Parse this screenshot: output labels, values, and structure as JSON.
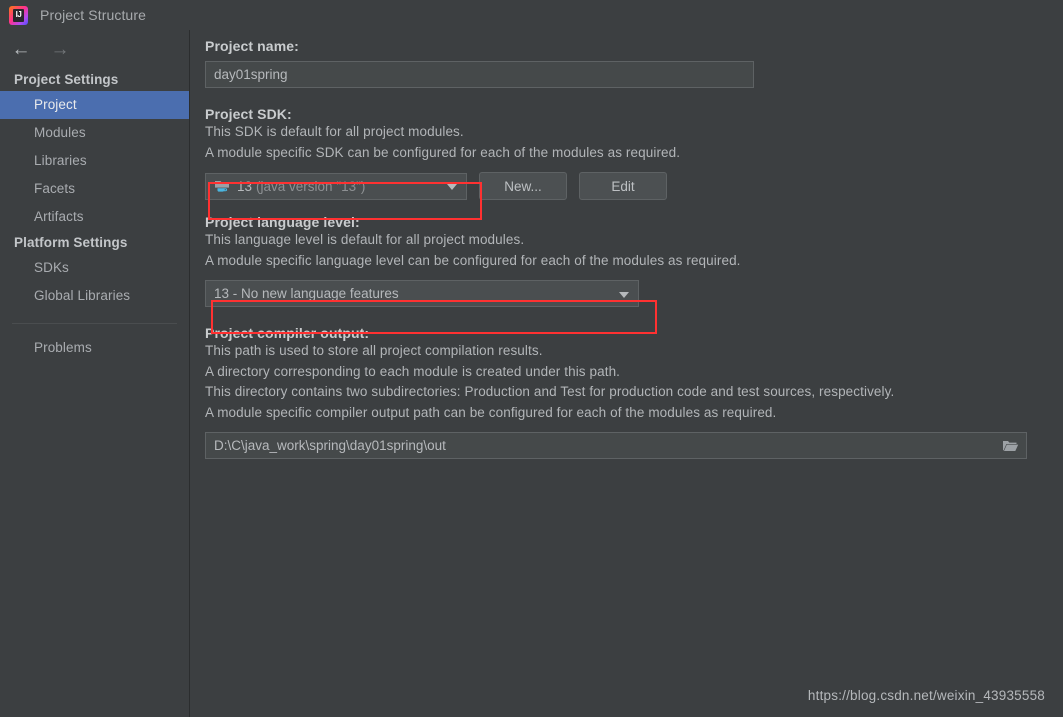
{
  "window": {
    "title": "Project Structure",
    "logo_icon": "intellij-idea-logo",
    "logo_text": "IJ"
  },
  "nav": {
    "back_icon": "arrow-left-icon",
    "forward_icon": "arrow-right-icon"
  },
  "sidebar": {
    "groups": [
      {
        "header": "Project Settings",
        "items": [
          {
            "label": "Project",
            "selected": true
          },
          {
            "label": "Modules",
            "selected": false
          },
          {
            "label": "Libraries",
            "selected": false
          },
          {
            "label": "Facets",
            "selected": false
          },
          {
            "label": "Artifacts",
            "selected": false
          }
        ]
      },
      {
        "header": "Platform Settings",
        "items": [
          {
            "label": "SDKs",
            "selected": false
          },
          {
            "label": "Global Libraries",
            "selected": false
          }
        ]
      }
    ],
    "problems_label": "Problems"
  },
  "main": {
    "project_name": {
      "label": "Project name:",
      "value": "day01spring"
    },
    "project_sdk": {
      "label": "Project SDK:",
      "description_lines": [
        "This SDK is default for all project modules.",
        "A module specific SDK can be configured for each of the modules as required."
      ],
      "selected": "13",
      "selected_detail": "(java version \"13\")",
      "sdk_icon": "java-sdk-folder-icon",
      "caret_icon": "chevron-down-icon",
      "new_button": "New...",
      "edit_button": "Edit"
    },
    "language_level": {
      "label": "Project language level:",
      "description_lines": [
        "This language level is default for all project modules.",
        "A module specific language level can be configured for each of the modules as required."
      ],
      "selected": "13 - No new language features",
      "caret_icon": "chevron-down-icon"
    },
    "compiler_output": {
      "label": "Project compiler output:",
      "description_lines": [
        "This path is used to store all project compilation results.",
        "A directory corresponding to each module is created under this path.",
        "This directory contains two subdirectories: Production and Test for production code and test sources, respectively.",
        "A module specific compiler output path can be configured for each of the modules as required."
      ],
      "value": "D:\\C\\java_work\\spring\\day01spring\\out",
      "browse_icon": "folder-browse-icon"
    }
  },
  "watermark": "https://blog.csdn.net/weixin_43935558",
  "colors": {
    "background": "#3c3f41",
    "selection_blue": "#4b6eaf",
    "annotation_red": "#ff3131",
    "text_primary": "#b2b5b8"
  }
}
